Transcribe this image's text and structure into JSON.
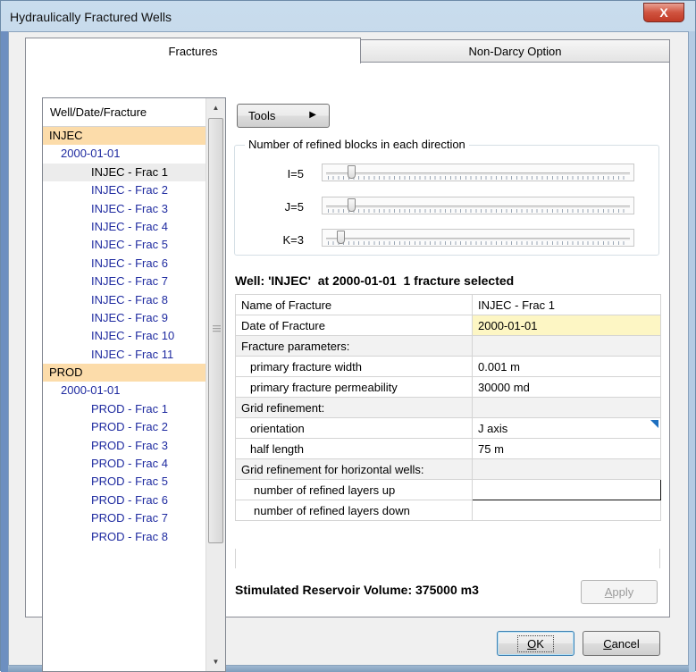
{
  "window": {
    "title": "Hydraulically Fractured Wells",
    "close_glyph": "X"
  },
  "tabs": [
    {
      "label": "Fractures",
      "active": true
    },
    {
      "label": "Non-Darcy Option",
      "active": false
    }
  ],
  "tree": {
    "header": "Well/Date/Fracture",
    "rows": [
      {
        "text": "INJEC",
        "kind": "well"
      },
      {
        "text": "2000-01-01",
        "kind": "date"
      },
      {
        "text": "INJEC - Frac 1",
        "kind": "frac",
        "selected": true
      },
      {
        "text": "INJEC - Frac 2",
        "kind": "frac"
      },
      {
        "text": "INJEC - Frac 3",
        "kind": "frac"
      },
      {
        "text": "INJEC - Frac 4",
        "kind": "frac"
      },
      {
        "text": "INJEC - Frac 5",
        "kind": "frac"
      },
      {
        "text": "INJEC - Frac 6",
        "kind": "frac"
      },
      {
        "text": "INJEC - Frac 7",
        "kind": "frac"
      },
      {
        "text": "INJEC - Frac 8",
        "kind": "frac"
      },
      {
        "text": "INJEC - Frac 9",
        "kind": "frac"
      },
      {
        "text": "INJEC - Frac 10",
        "kind": "frac"
      },
      {
        "text": "INJEC - Frac 11",
        "kind": "frac"
      },
      {
        "text": "PROD",
        "kind": "well"
      },
      {
        "text": "2000-01-01",
        "kind": "date"
      },
      {
        "text": "PROD - Frac 1",
        "kind": "frac"
      },
      {
        "text": "PROD - Frac 2",
        "kind": "frac"
      },
      {
        "text": "PROD - Frac 3",
        "kind": "frac"
      },
      {
        "text": "PROD - Frac 4",
        "kind": "frac"
      },
      {
        "text": "PROD - Frac 5",
        "kind": "frac"
      },
      {
        "text": "PROD - Frac 6",
        "kind": "frac"
      },
      {
        "text": "PROD - Frac 7",
        "kind": "frac"
      },
      {
        "text": "PROD - Frac 8",
        "kind": "frac"
      }
    ]
  },
  "tools": {
    "label": "Tools"
  },
  "refine": {
    "title": "Number of refined blocks in each direction",
    "sliders": [
      {
        "label": "I=5",
        "value": 5
      },
      {
        "label": "J=5",
        "value": 5
      },
      {
        "label": "K=3",
        "value": 3
      }
    ]
  },
  "selection_info": "Well: 'INJEC'  at 2000-01-01  1 fracture selected",
  "properties": [
    {
      "name": "Name of Fracture",
      "value": "INJEC - Frac 1",
      "style": "plain"
    },
    {
      "name": "Date of Fracture",
      "value": "2000-01-01",
      "style": "date"
    },
    {
      "name": "Fracture parameters:",
      "value": "",
      "style": "section"
    },
    {
      "name": "primary fracture width",
      "value": "0.001 m",
      "style": "indent"
    },
    {
      "name": "primary fracture permeability",
      "value": "30000 md",
      "style": "indent"
    },
    {
      "name": "Grid refinement:",
      "value": "",
      "style": "section"
    },
    {
      "name": "orientation",
      "value": "J axis",
      "style": "indent-drop"
    },
    {
      "name": "half length",
      "value": "75 m",
      "style": "indent"
    },
    {
      "name": "Grid refinement for horizontal wells:",
      "value": "",
      "style": "section"
    },
    {
      "name": "number of refined layers up",
      "value": "",
      "style": "indent2-focus"
    },
    {
      "name": "number of refined layers down",
      "value": "",
      "style": "indent2"
    }
  ],
  "srv": "Stimulated Reservoir Volume: 375000 m3",
  "buttons": {
    "apply": "Apply",
    "ok": "OK",
    "cancel": "Cancel"
  }
}
